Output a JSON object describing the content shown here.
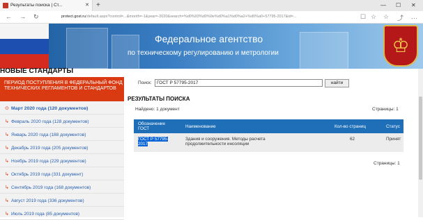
{
  "browser": {
    "tab_title": "Результаты поиска | Ст...",
    "url_host": "protect.gost.ru",
    "url_rest": "/default.aspx?control=...&month=-1&year=-2020&search=%d0%93%d0%9e%d0%a1%d0%a2+%d0%a0+57795-2017&id=...",
    "url_prefix": "",
    "close_glyph": "✕",
    "new_tab_glyph": "+",
    "back_glyph": "←",
    "forward_glyph": "→",
    "refresh_glyph": "↻",
    "min_glyph": "—",
    "max_glyph": "☐",
    "win_close_glyph": "✕",
    "reading_glyph": "☐",
    "star_glyph": "☆",
    "favs_glyph": "☆",
    "share_glyph": "⤴",
    "more_glyph": "…"
  },
  "banner": {
    "title": "Федеральное агентство",
    "subtitle": "по техническому регулированию и метрологии",
    "crest_glyph": "♔"
  },
  "sidebar": {
    "heading": "НОВЫЕ СТАНДАРТЫ",
    "red_header": "ПЕРИОД ПОСТУПЛЕНИЯ В ФЕДЕРАЛЬНЫЙ ФОНД ТЕХНИЧЕСКИХ РЕГЛАМЕНТОВ И СТАНДАРТОВ",
    "items": [
      {
        "label": "Март 2020 года (120 документов)",
        "icon": "⊙"
      },
      {
        "label": "Февраль 2020 года (128 документов)",
        "icon": "↳"
      },
      {
        "label": "Январь 2020 года (188 документов)",
        "icon": "↳"
      },
      {
        "label": "Декабрь 2019 года (205 документов)",
        "icon": "↳"
      },
      {
        "label": "Ноябрь 2019 года (229 документов)",
        "icon": "↳"
      },
      {
        "label": "Октябрь 2019 года (331 документ)",
        "icon": "↳"
      },
      {
        "label": "Сентябрь 2019 года (168 документов)",
        "icon": "↳"
      },
      {
        "label": "Август 2019 года (336 документов)",
        "icon": "↳"
      },
      {
        "label": "Июль 2019 года (85 документов)",
        "icon": "↳"
      }
    ]
  },
  "search": {
    "label": "Поиск:",
    "value": "ГОСТ Р 57795-2017",
    "button": "найти"
  },
  "results": {
    "title": "РЕЗУЛЬТАТЫ ПОИСКА",
    "found": "Найдено: 1 документ",
    "pages_top": "Страницы: 1",
    "pages_bottom": "Страницы: 1",
    "columns": {
      "designation_line1": "Обозначение",
      "designation_line2": "ГОСТ",
      "name": "Наименование",
      "pages": "Кол-во страниц",
      "status": "Статус"
    },
    "rows": [
      {
        "designation_line1": "ГОСТ Р 57795-",
        "designation_line2": "2017",
        "name_line1": "Здания и сооружения. Методы расчета",
        "name_line2": "продолжительности инсоляции",
        "pages": "62",
        "status": "Принят"
      }
    ]
  }
}
